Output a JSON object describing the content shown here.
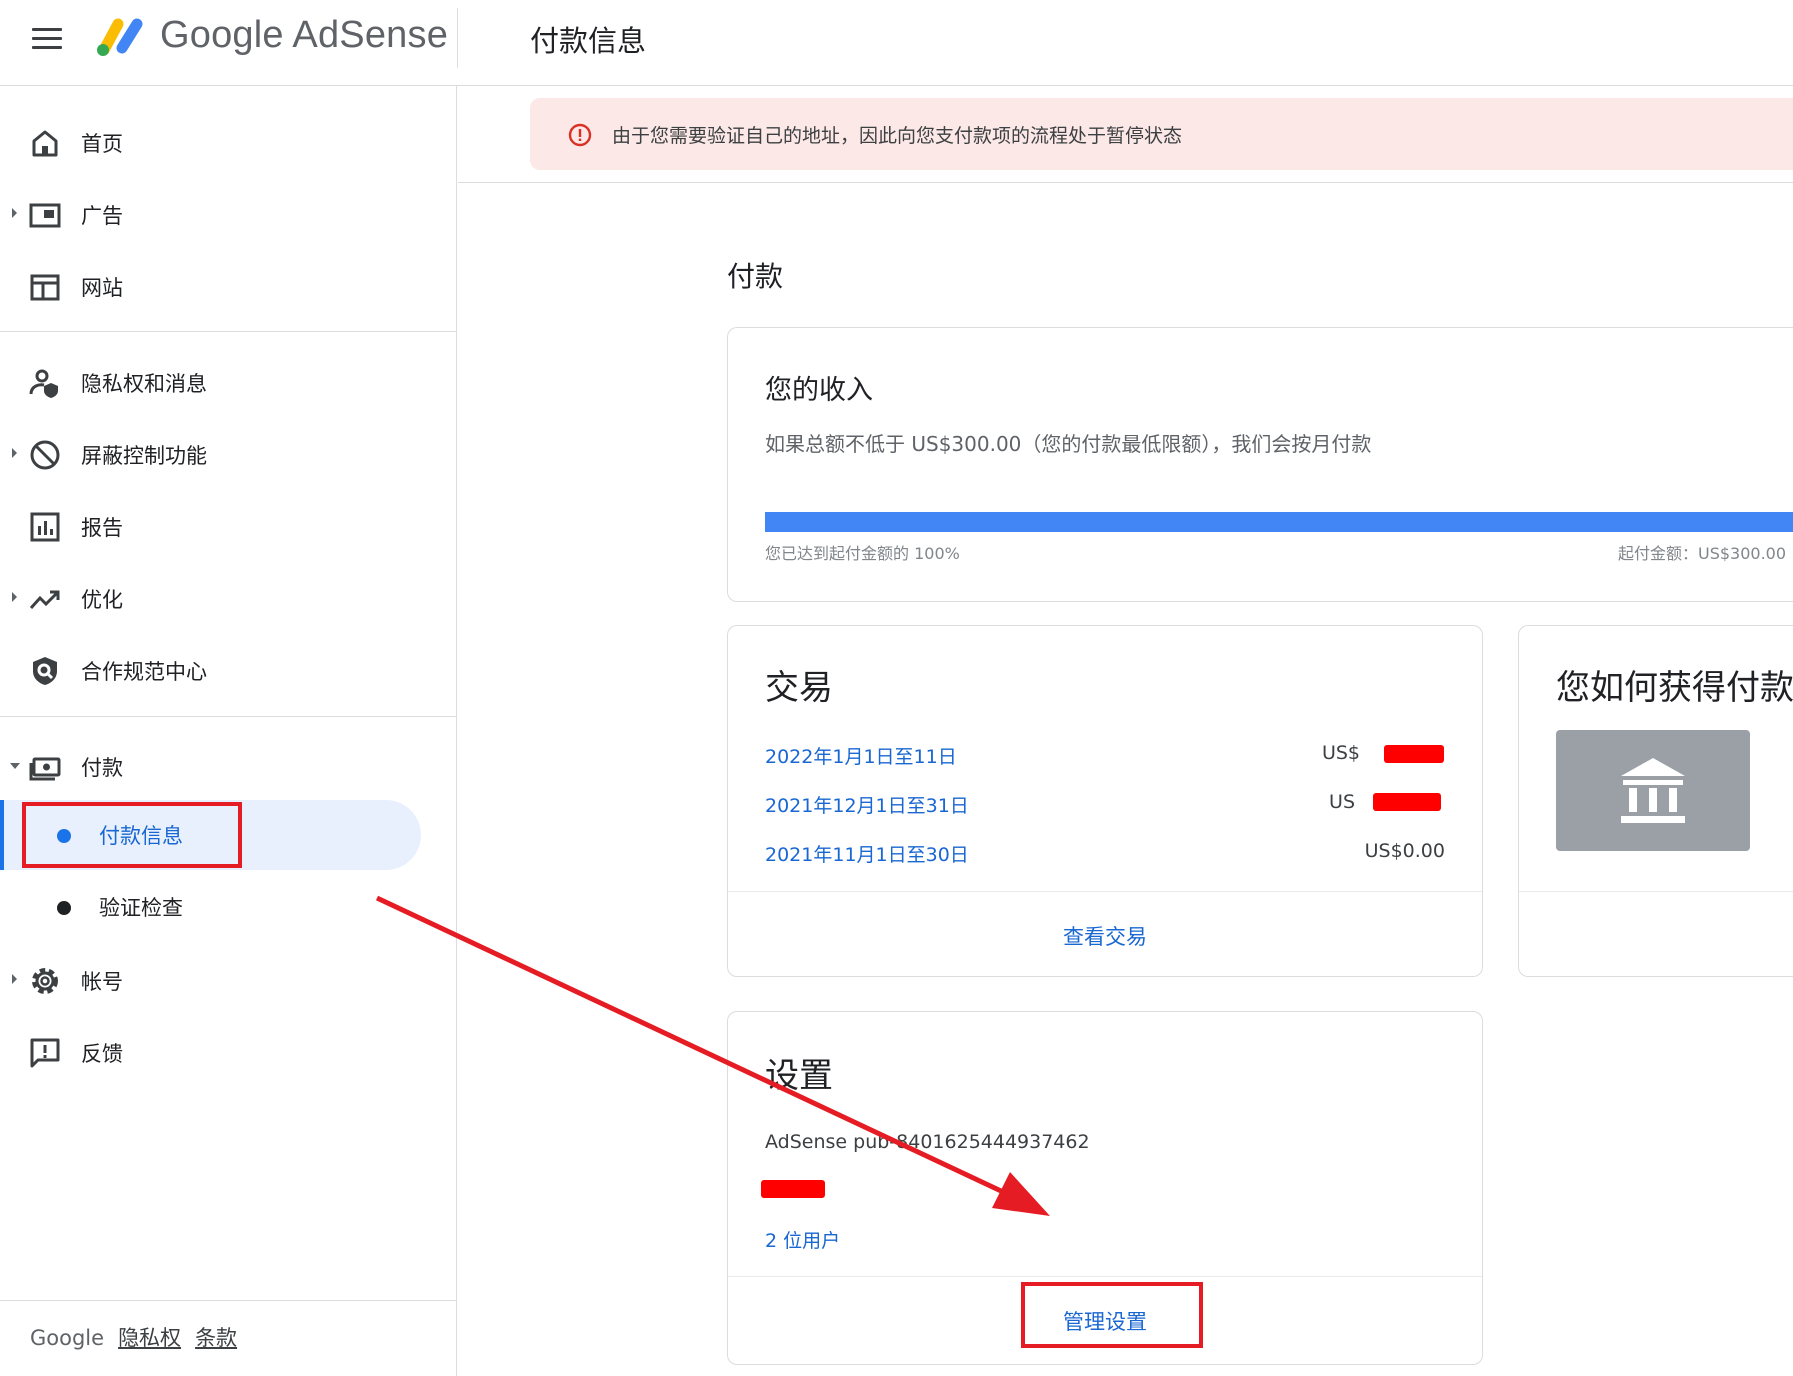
{
  "header": {
    "menu_icon": "menu-icon",
    "brand": "Google AdSense",
    "page_title": "付款信息"
  },
  "sidebar": {
    "items": [
      {
        "label": "首页",
        "icon": "home-icon"
      },
      {
        "label": "广告",
        "icon": "ads-icon"
      },
      {
        "label": "网站",
        "icon": "sites-icon"
      },
      {
        "label": "隐私权和消息",
        "icon": "privacy-icon"
      },
      {
        "label": "屏蔽控制功能",
        "icon": "block-icon"
      },
      {
        "label": "报告",
        "icon": "reports-icon"
      },
      {
        "label": "优化",
        "icon": "trending-icon"
      },
      {
        "label": "合作规范中心",
        "icon": "policy-icon"
      },
      {
        "label": "付款",
        "icon": "payments-icon"
      },
      {
        "label": "帐号",
        "icon": "gear-icon"
      },
      {
        "label": "反馈",
        "icon": "feedback-icon"
      }
    ],
    "payments_sub": [
      {
        "label": "付款信息",
        "active": true
      },
      {
        "label": "验证检查",
        "active": false
      }
    ],
    "footer": {
      "brand": "Google",
      "privacy": "隐私权",
      "terms": "条款"
    }
  },
  "alert": {
    "icon": "error-icon",
    "text": "由于您需要验证自己的地址，因此向您支付款项的流程处于暂停状态",
    "color": "#fce8e6"
  },
  "main": {
    "section_title": "付款",
    "earnings": {
      "title": "您的收入",
      "description": "如果总额不低于 US$300.00（您的付款最低限额），我们会按月付款",
      "progress_fraction": 1.0,
      "progress_text": "您已达到起付金额的 100%",
      "threshold_text": "起付金额：US$300.00"
    },
    "transactions": {
      "title": "交易",
      "rows": [
        {
          "date": "2022年1月1日至11日",
          "amount": "US$"
        },
        {
          "date": "2021年12月1日至31日",
          "amount": "US"
        },
        {
          "date": "2021年11月1日至30日",
          "amount": "US$0.00"
        }
      ],
      "link": "查看交易"
    },
    "how_paid": {
      "title": "您如何获得付款",
      "icon": "bank-icon"
    },
    "settings": {
      "title": "设置",
      "publisher": "AdSense pub-8401625444937462",
      "users": "2 位用户",
      "link": "管理设置"
    }
  },
  "colors": {
    "accent": "#1a73e8",
    "progress": "#4285f4",
    "annotation": "#e51c23"
  }
}
